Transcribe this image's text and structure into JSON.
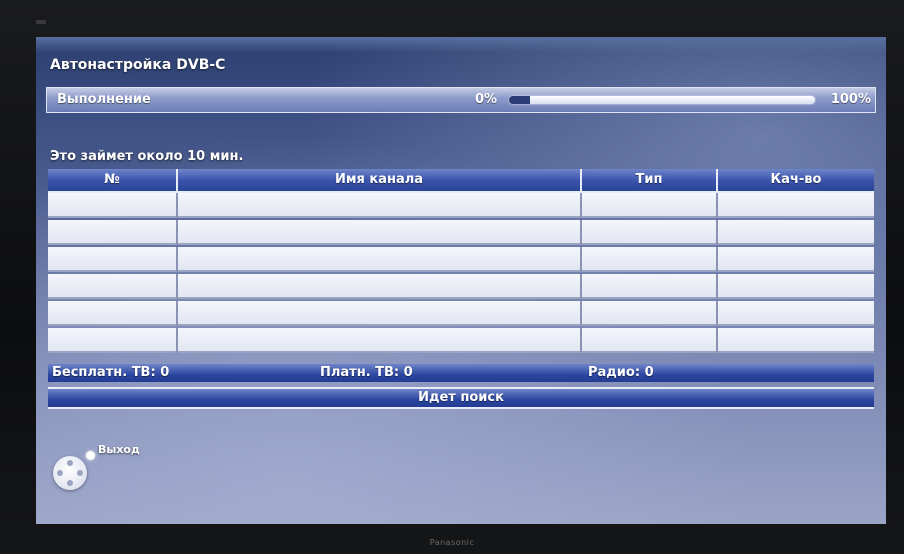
{
  "window": {
    "title": "Автонастройка DVB-C",
    "brand": "Panasonic"
  },
  "progress": {
    "label": "Выполнение",
    "start_label": "0%",
    "end_label": "100%",
    "fraction": 0.07
  },
  "eta_text": "Это займет около 10 мин.",
  "table": {
    "columns": [
      "№",
      "Имя канала",
      "Тип",
      "Кач-во"
    ],
    "rows": [
      [
        "",
        "",
        "",
        ""
      ],
      [
        "",
        "",
        "",
        ""
      ],
      [
        "",
        "",
        "",
        ""
      ],
      [
        "",
        "",
        "",
        ""
      ],
      [
        "",
        "",
        "",
        ""
      ],
      [
        "",
        "",
        "",
        ""
      ]
    ]
  },
  "summary": {
    "free_tv": "Бесплатн. ТВ: 0",
    "pay_tv": "Платн. ТВ: 0",
    "radio": "Радио: 0"
  },
  "status_text": "Идет поиск",
  "exit": {
    "label": "Выход",
    "icon": "remote-dpad-icon"
  },
  "colors": {
    "header_blue": "#2a4498",
    "row_bg": "#eef1f8",
    "screen_bg": "#4a5c8f"
  }
}
